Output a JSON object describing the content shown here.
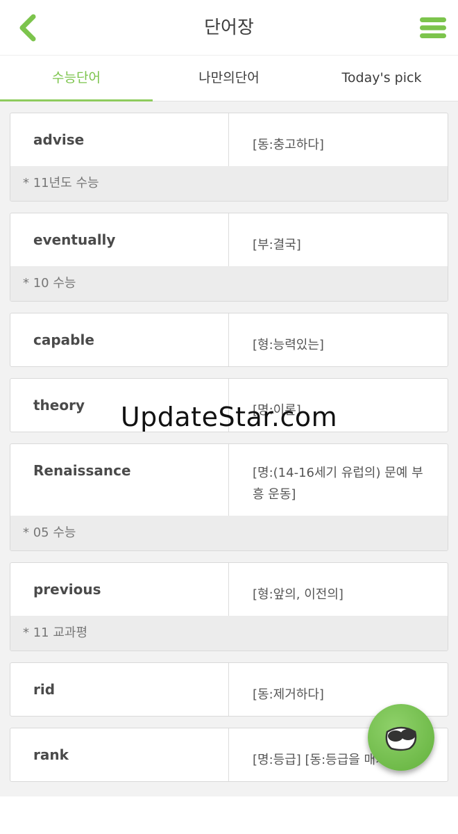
{
  "header": {
    "title": "단어장"
  },
  "tabs": [
    {
      "label": "수능단어",
      "active": true
    },
    {
      "label": "나만의단어",
      "active": false
    },
    {
      "label": "Today's pick",
      "active": false
    }
  ],
  "words": [
    {
      "word": "advise",
      "meaning": "[동:충고하다]",
      "note": "* 11년도 수능"
    },
    {
      "word": "eventually",
      "meaning": "[부:결국]",
      "note": "* 10 수능"
    },
    {
      "word": "capable",
      "meaning": "[형:능력있는]",
      "note": ""
    },
    {
      "word": "theory",
      "meaning": "[명:이론]",
      "note": ""
    },
    {
      "word": "Renaissance",
      "meaning": "[명:(14-16세기 유럽의) 문예 부흥 운동]",
      "note": "* 05 수능"
    },
    {
      "word": "previous",
      "meaning": "[형:앞의, 이전의]",
      "note": "* 11 교과평"
    },
    {
      "word": "rid",
      "meaning": "[동:제거하다]",
      "note": ""
    },
    {
      "word": "rank",
      "meaning": "[명:등급] [동:등급을 매기",
      "note": ""
    }
  ],
  "watermark": "UpdateStar.com",
  "colors": {
    "accent": "#8ecb5d",
    "fab": "#6cbc45"
  },
  "icons": {
    "back": "chevron-left-icon",
    "menu": "hamburger-menu-icon",
    "fab": "sunglasses-icon"
  }
}
